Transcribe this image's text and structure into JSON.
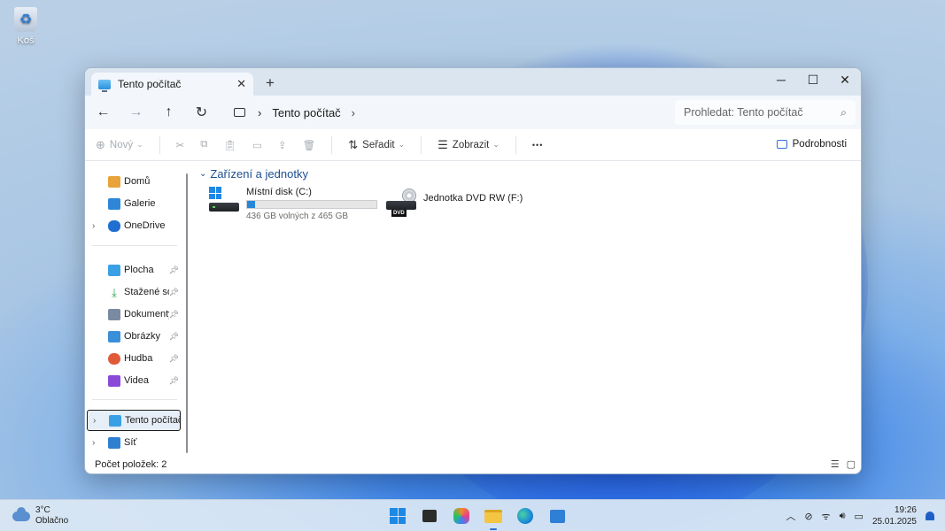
{
  "desktop": {
    "recycle_bin_label": "Koš"
  },
  "window": {
    "tab_title": "Tento počítač",
    "tab_close": "✕",
    "new_tab": "+",
    "controls": {
      "minimize": "─",
      "maximize": "☐",
      "close": "✕"
    },
    "address": {
      "segment": "Tento počítač",
      "sep1": "›",
      "sep2": "›"
    },
    "search_placeholder": "Prohledat: Tento počítač",
    "toolbar": {
      "new_label": "Nový",
      "sort_label": "Seřadit",
      "view_label": "Zobrazit",
      "more_label": "•••",
      "details_label": "Podrobnosti"
    }
  },
  "sidebar": {
    "items": [
      {
        "label": "Domů",
        "color": "#e8a33a"
      },
      {
        "label": "Galerie",
        "color": "#2f86d8"
      },
      {
        "label": "OneDrive",
        "color": "#1e6fd0"
      },
      {
        "label": "Plocha",
        "color": "#3aa0e6"
      },
      {
        "label": "Stažené soubory",
        "color": "#2aa04a"
      },
      {
        "label": "Dokumenty",
        "color": "#7a8aa0"
      },
      {
        "label": "Obrázky",
        "color": "#3b8fd8"
      },
      {
        "label": "Hudba",
        "color": "#e05a3a"
      },
      {
        "label": "Videa",
        "color": "#8a4ad8"
      },
      {
        "label": "Tento počítač",
        "color": "#3aa0e6"
      },
      {
        "label": "Síť",
        "color": "#2f7fd0"
      }
    ]
  },
  "content": {
    "group_title": "Zařízení a jednotky",
    "drives": [
      {
        "name": "Místní disk (C:)",
        "free_text": "436 GB volných z 465 GB",
        "used_fraction": 0.06
      },
      {
        "name": "Jednotka DVD RW (F:)",
        "tag": "DVD"
      }
    ]
  },
  "status": {
    "count_text": "Počet položek: 2"
  },
  "taskbar": {
    "weather_temp": "3°C",
    "weather_text": "Oblačno",
    "time": "19:26",
    "date": "25.01.2025",
    "accent": "#2f6fd6"
  }
}
